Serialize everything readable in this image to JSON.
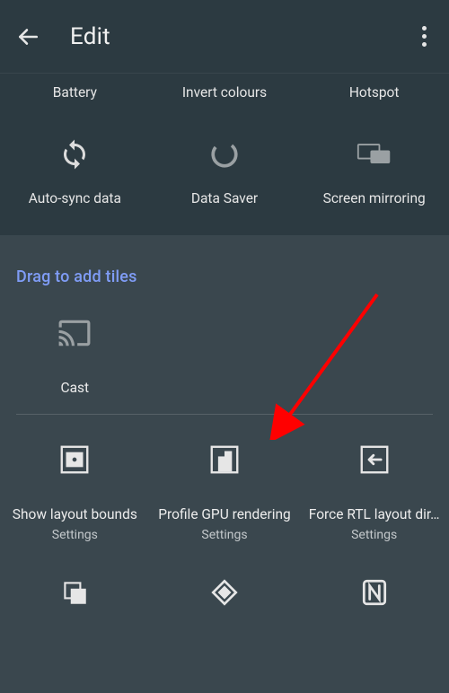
{
  "header": {
    "title": "Edit"
  },
  "current_tiles": {
    "row1_labels": [
      "Battery",
      "Invert colours",
      "Hotspot"
    ],
    "row2": [
      {
        "label": "Auto-sync data",
        "icon": "sync-icon"
      },
      {
        "label": "Data Saver",
        "icon": "data-saver-icon"
      },
      {
        "label": "Screen mirroring",
        "icon": "screen-mirroring-icon"
      }
    ]
  },
  "available": {
    "section_title": "Drag to add tiles",
    "row1": [
      {
        "label": "Cast",
        "icon": "cast-icon"
      }
    ],
    "row2": [
      {
        "label": "Show layout bounds",
        "sub": "Settings",
        "icon": "layout-bounds-icon"
      },
      {
        "label": "Profile GPU rendering",
        "sub": "Settings",
        "icon": "profile-gpu-icon"
      },
      {
        "label": "Force RTL layout dir…",
        "sub": "Settings",
        "icon": "force-rtl-icon"
      }
    ],
    "row3": [
      {
        "icon": "windows-icon"
      },
      {
        "icon": "diamond-icon"
      },
      {
        "icon": "nfc-icon"
      }
    ]
  }
}
